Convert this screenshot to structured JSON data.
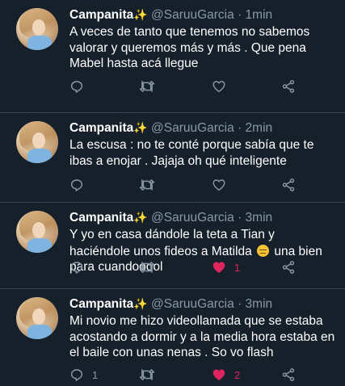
{
  "tweets": [
    {
      "name": "Campanita",
      "sparkle": "✨",
      "handle": "@SaruuGarcia",
      "dot": "·",
      "time": "1min",
      "text": "A veces de tanto que tenemos no sabemos valorar y queremos más y más . Que pena Mabel hasta acá llegue",
      "reply_count": "",
      "like_count": "",
      "liked": false
    },
    {
      "name": "Campanita",
      "sparkle": "✨",
      "handle": "@SaruuGarcia",
      "dot": "·",
      "time": "2min",
      "text": "La escusa : no te conté porque sabía que te ibas a enojar . Jajaja oh qué inteligente",
      "reply_count": "",
      "like_count": "",
      "liked": false
    },
    {
      "name": "Campanita",
      "sparkle": "✨",
      "handle": "@SaruuGarcia",
      "dot": "·",
      "time": "3min",
      "text_before": "Y yo en casa dándole la teta a Tian y haciéndole unos fideos a Matilda",
      "text_after": "una bien para cuandooool",
      "reply_count": "",
      "like_count": "1",
      "liked": true
    },
    {
      "name": "Campanita",
      "sparkle": "✨",
      "handle": "@SaruuGarcia",
      "dot": "·",
      "time": "3min",
      "text": "Mi novio me hizo videollamada que se estaba acostando a dormir y a la media hora estaba en el baile con unas nenas . So vo flash",
      "reply_count": "1",
      "like_count": "2",
      "liked": true
    }
  ],
  "icons": {
    "reply": "reply-icon",
    "retweet": "retweet-icon",
    "like": "like-icon",
    "share": "share-icon"
  },
  "colors": {
    "background": "#15202b",
    "muted": "#8899a6",
    "like": "#e0245e",
    "divider": "#38444d"
  }
}
